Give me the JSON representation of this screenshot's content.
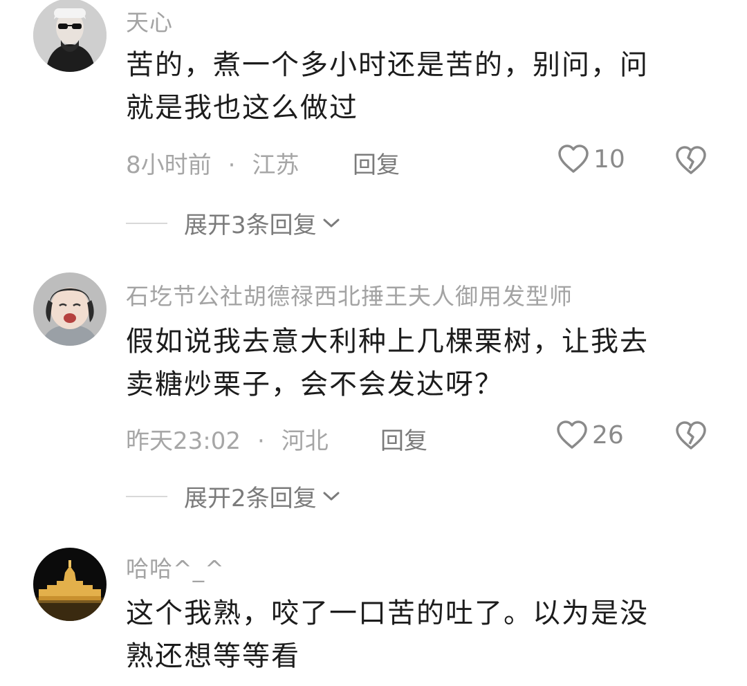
{
  "comments": [
    {
      "username": "天心",
      "text_lines": [
        "苦的，煮一个多小时还是苦的，别问，问",
        "就是我也这么做过"
      ],
      "time": "8小时前",
      "location": "江苏",
      "reply_label": "回复",
      "likes": "10",
      "expand_label": "展开3条回复",
      "avatar_icon": "woman-sunglasses-avatar"
    },
    {
      "username": "石圪节公社胡德禄西北捶王夫人御用发型师",
      "text_lines": [
        "假如说我去意大利种上几棵栗树，让我去",
        "卖糖炒栗子，会不会发达呀？"
      ],
      "time": "昨天23:02",
      "location": "河北",
      "reply_label": "回复",
      "likes": "26",
      "expand_label": "展开2条回复",
      "avatar_icon": "crying-child-avatar"
    },
    {
      "username": "哈哈^_^",
      "text_lines": [
        "这个我熟，咬了一口苦的吐了。以为是没",
        "熟还想等等看"
      ],
      "avatar_icon": "night-palace-avatar"
    }
  ],
  "meta_separator": "·",
  "colors": {
    "username": "#a3a3a3",
    "body_text": "#1c1c1c",
    "meta_text": "#a6a6a6",
    "icon_gray": "#8a8a8a"
  }
}
